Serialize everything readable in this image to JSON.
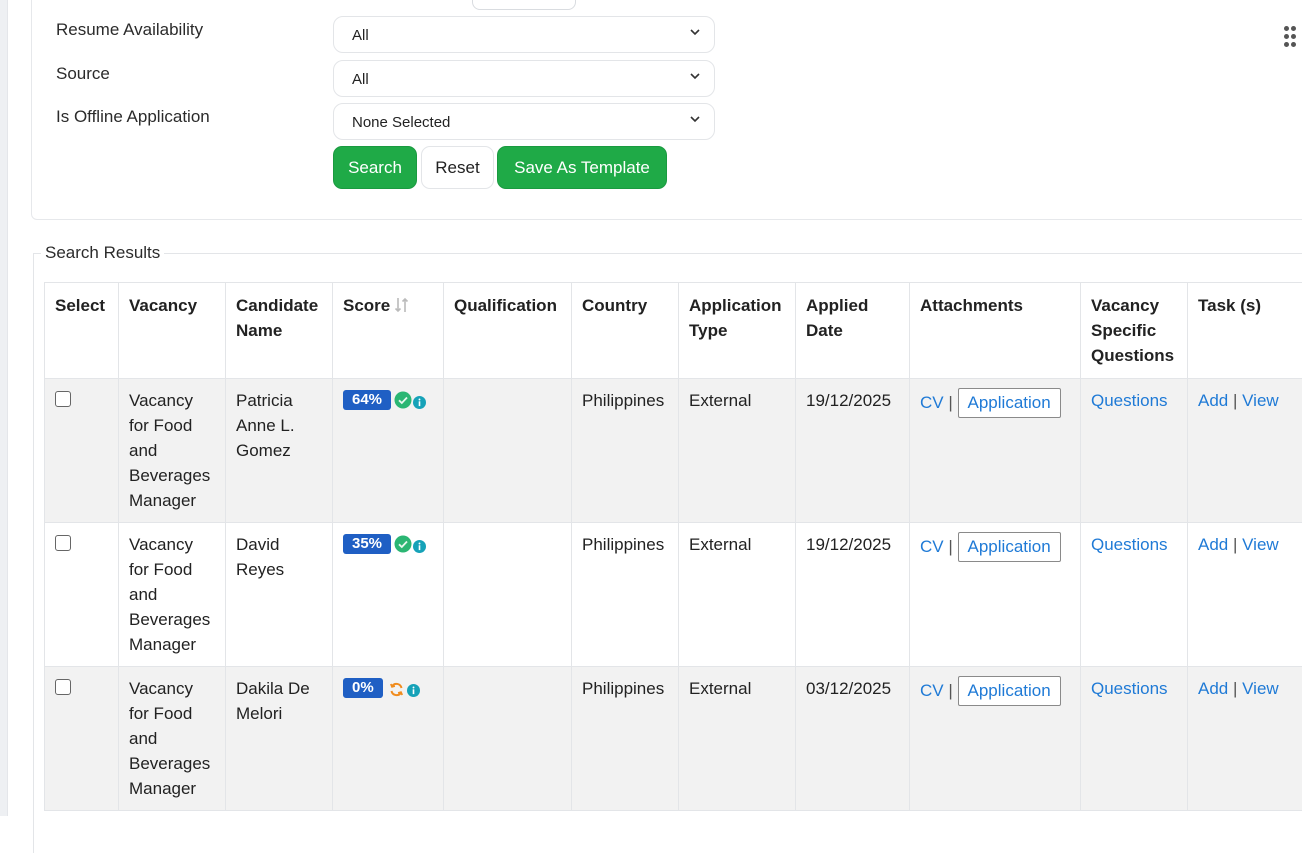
{
  "filters": {
    "resume_availability": {
      "label": "Resume Availability",
      "value": "All"
    },
    "source": {
      "label": "Source",
      "value": "All"
    },
    "offline_application": {
      "label": "Is Offline Application",
      "value": "None Selected"
    }
  },
  "buttons": {
    "search": "Search",
    "reset": "Reset",
    "save_template": "Save As Template"
  },
  "results": {
    "legend": "Search Results",
    "columns": {
      "select": "Select",
      "vacancy": "Vacancy",
      "candidate": "Candidate Name",
      "score": "Score",
      "qualification": "Qualification",
      "country": "Country",
      "application_type": "Application Type",
      "applied_date": "Applied Date",
      "attachments": "Attachments",
      "vacancy_questions": "Vacancy Specific Questions",
      "tasks": "Task (s)"
    },
    "rows": [
      {
        "vacancy": "Vacancy for Food and Beverages Manager",
        "candidate": "Patricia Anne L. Gomez",
        "score": "64%",
        "score_status": "check",
        "qualification": "",
        "country": "Philippines",
        "application_type": "External",
        "applied_date": "19/12/2025",
        "cv": "CV",
        "application": "Application",
        "questions": "Questions",
        "add": "Add",
        "view": "View"
      },
      {
        "vacancy": "Vacancy for Food and Beverages Manager",
        "candidate": "David Reyes",
        "score": "35%",
        "score_status": "check",
        "qualification": "",
        "country": "Philippines",
        "application_type": "External",
        "applied_date": "19/12/2025",
        "cv": "CV",
        "application": "Application",
        "questions": "Questions",
        "add": "Add",
        "view": "View"
      },
      {
        "vacancy": "Vacancy for Food and Beverages Manager",
        "candidate": "Dakila De Melori",
        "score": "0%",
        "score_status": "refresh",
        "qualification": "",
        "country": "Philippines",
        "application_type": "External",
        "applied_date": "03/12/2025",
        "cv": "CV",
        "application": "Application",
        "questions": "Questions",
        "add": "Add",
        "view": "View"
      }
    ]
  },
  "colors": {
    "primary_green": "#1faa47",
    "badge_blue": "#1f5fc4",
    "link_blue": "#1f7ad6",
    "status_green": "#2bb673",
    "info_teal": "#16a2b8",
    "refresh_orange": "#f08c1e"
  },
  "icons": {
    "select_chevron": "chevron-down-icon",
    "grip": "grip-dots-icon",
    "sort": "sort-icon",
    "score_ok": "check-circle-icon",
    "score_pending": "refresh-icon",
    "score_info": "info-icon"
  }
}
